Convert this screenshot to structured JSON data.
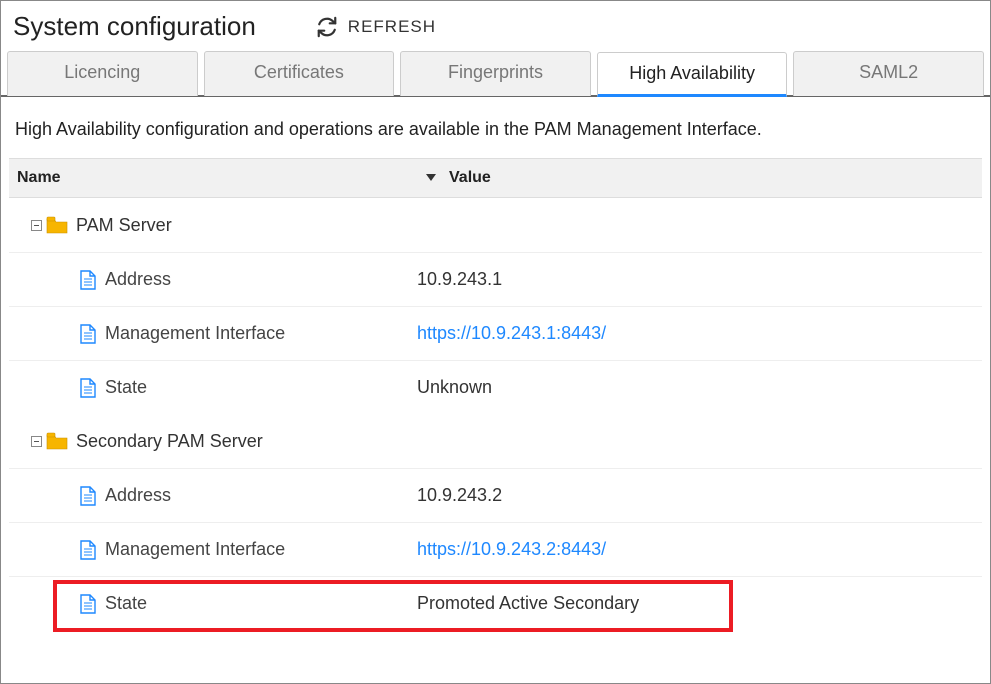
{
  "header": {
    "title": "System configuration",
    "refresh_label": "REFRESH"
  },
  "tabs": [
    {
      "label": "Licencing",
      "active": false
    },
    {
      "label": "Certificates",
      "active": false
    },
    {
      "label": "Fingerprints",
      "active": false
    },
    {
      "label": "High Availability",
      "active": true
    },
    {
      "label": "SAML2",
      "active": false
    }
  ],
  "description": "High Availability configuration and operations are available in the PAM Management Interface.",
  "columns": {
    "name": "Name",
    "value": "Value"
  },
  "tree": [
    {
      "label": "PAM Server",
      "children": [
        {
          "name": "Address",
          "value": "10.9.243.1",
          "link": false
        },
        {
          "name": "Management Interface",
          "value": "https://10.9.243.1:8443/",
          "link": true
        },
        {
          "name": "State",
          "value": "Unknown",
          "link": false
        }
      ]
    },
    {
      "label": "Secondary PAM Server",
      "children": [
        {
          "name": "Address",
          "value": "10.9.243.2",
          "link": false
        },
        {
          "name": "Management Interface",
          "value": "https://10.9.243.2:8443/",
          "link": true
        },
        {
          "name": "State",
          "value": "Promoted Active Secondary",
          "link": false
        }
      ]
    }
  ]
}
